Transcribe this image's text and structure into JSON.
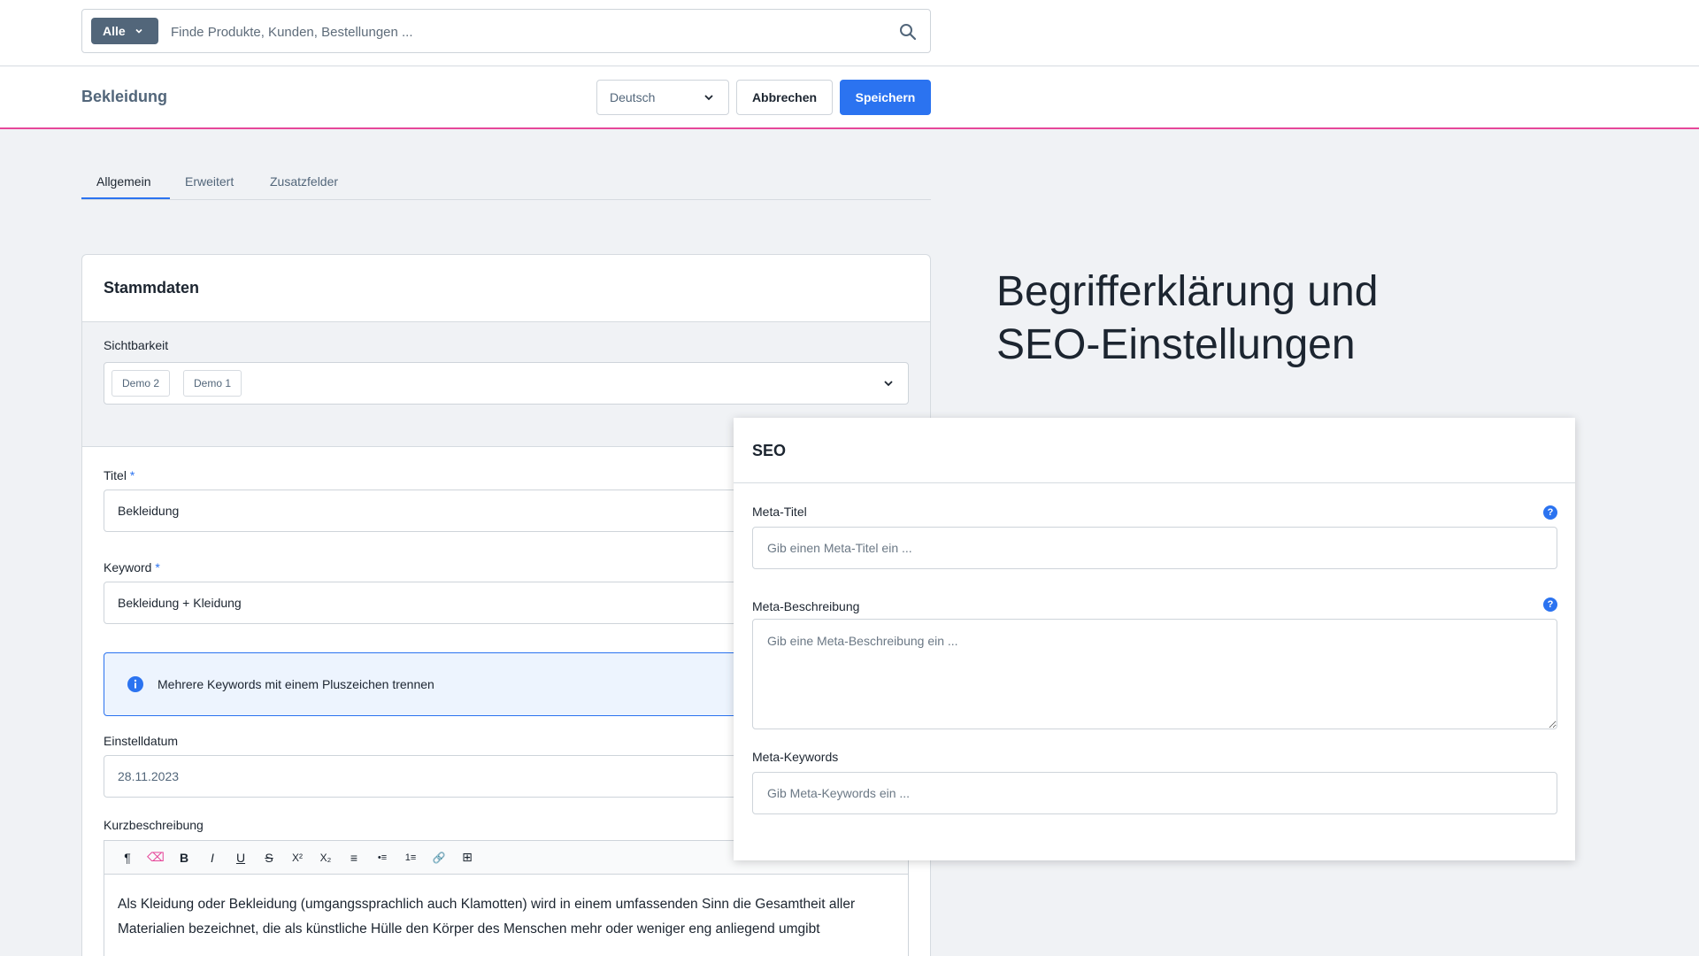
{
  "search": {
    "type_label": "Alle",
    "placeholder": "Finde Produkte, Kunden, Bestellungen ..."
  },
  "smartbar": {
    "title": "Bekleidung",
    "language": "Deutsch",
    "cancel_label": "Abbrechen",
    "save_label": "Speichern"
  },
  "tabs": [
    {
      "label": "Allgemein",
      "active": true
    },
    {
      "label": "Erweitert",
      "active": false
    },
    {
      "label": "Zusatzfelder",
      "active": false
    }
  ],
  "card": {
    "title": "Stammdaten",
    "visibility_label": "Sichtbarkeit",
    "visibility_chips": [
      "Demo 2",
      "Demo 1"
    ],
    "title_label": "Titel",
    "title_value": "Bekleidung",
    "keyword_label": "Keyword",
    "keyword_value": "Bekleidung + Kleidung",
    "required_marker": "*",
    "info_text": "Mehrere Keywords mit einem Pluszeichen trennen",
    "date_label": "Einstelldatum",
    "date_value": "28.11.2023",
    "short_desc_label": "Kurzbeschreibung",
    "toolbar": [
      "¶",
      "⌫",
      "B",
      "I",
      "U",
      "S",
      "X²",
      "X₂",
      "≡",
      "•≡",
      "1≡",
      "🔗",
      "⊞"
    ],
    "short_desc_text": "Als Kleidung oder Bekleidung (umgangssprachlich auch Klamotten) wird in einem umfassenden Sinn die Gesamtheit aller Materialien bezeichnet, die als künstliche Hülle den Körper des Menschen mehr oder weniger eng anliegend umgibt"
  },
  "hero": {
    "line1": "Begrifferklärung und",
    "line2": "SEO-Einstellungen"
  },
  "seo": {
    "title": "SEO",
    "meta_title_label": "Meta-Titel",
    "meta_title_placeholder": "Gib einen Meta-Titel ein ...",
    "meta_desc_label": "Meta-Beschreibung",
    "meta_desc_placeholder": "Gib eine Meta-Beschreibung ein ...",
    "meta_keywords_label": "Meta-Keywords",
    "meta_keywords_placeholder": "Gib Meta-Keywords ein ...",
    "help_glyph": "?"
  },
  "colors": {
    "primary": "#2b73f0",
    "accent_border": "#e6479a",
    "type_badge": "#52667a"
  }
}
